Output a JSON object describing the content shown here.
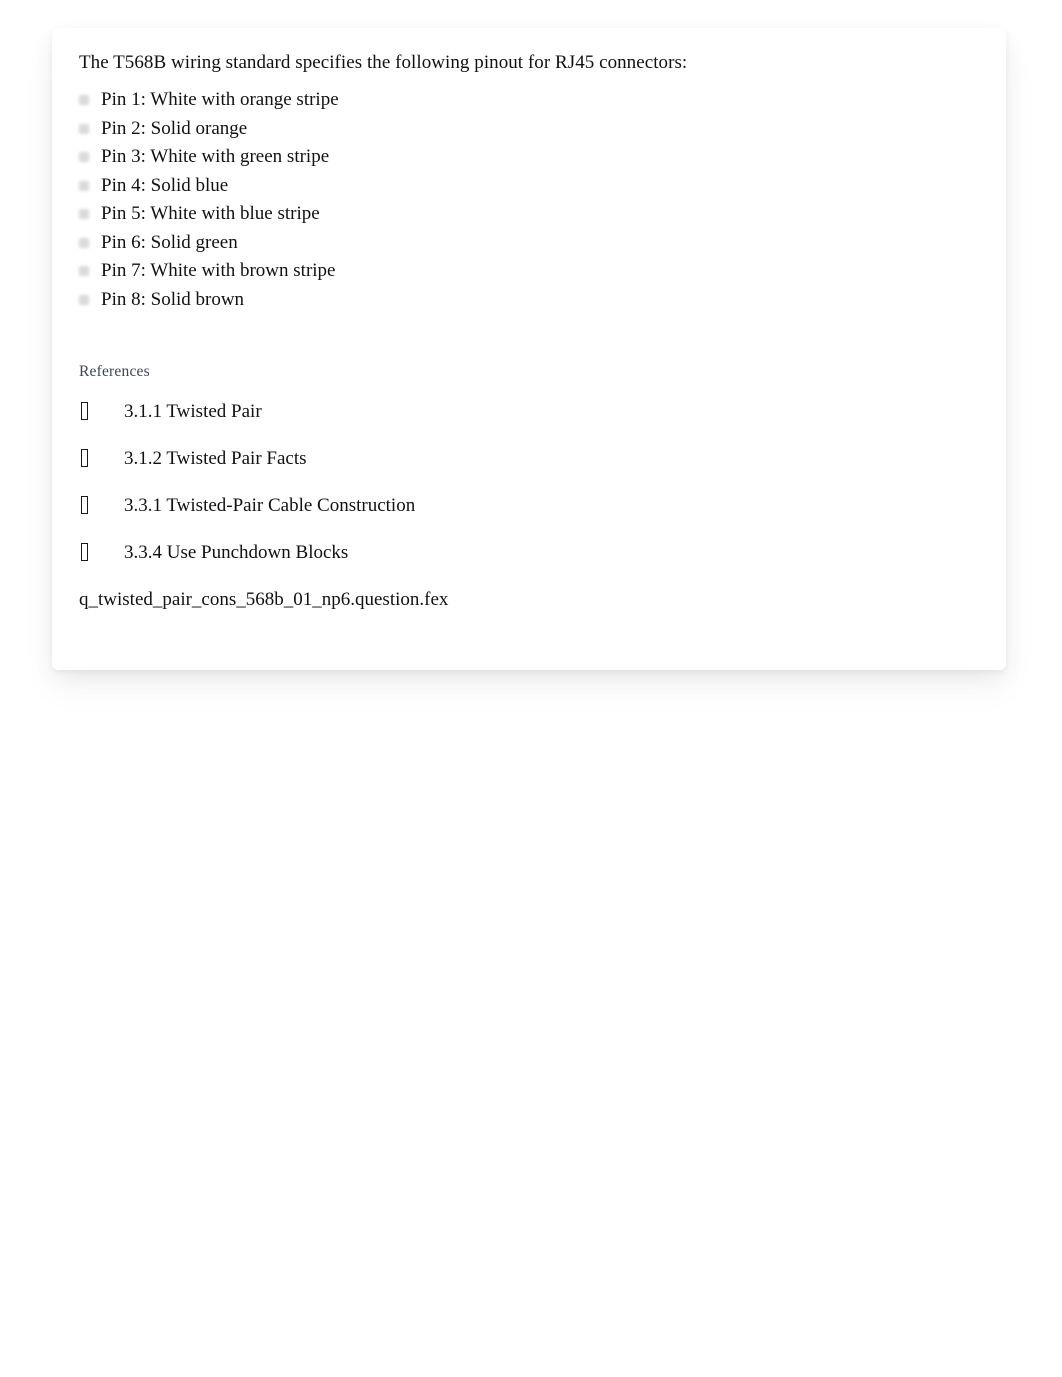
{
  "card": {
    "intro": "The T568B wiring standard specifies the following pinout for RJ45 connectors:",
    "pinout": [
      "Pin 1: White with orange stripe",
      "Pin 2: Solid orange",
      "Pin 3: White with green stripe",
      "Pin 4: Solid blue",
      "Pin 5: White with blue stripe",
      "Pin 6: Solid green",
      "Pin 7: White with brown stripe",
      "Pin 8: Solid brown"
    ],
    "references": {
      "heading": "References",
      "items": [
        "3.1.1 Twisted Pair",
        "3.1.2 Twisted Pair Facts",
        "3.3.1 Twisted-Pair Cable Construction",
        "3.3.4 Use Punchdown Blocks"
      ],
      "bullet_icon": "missing-glyph-box-icon"
    },
    "filename": "q_twisted_pair_cons_568b_01_np6.question.fex",
    "colors": {
      "body_text": "#111111",
      "references_heading": "#3d4557",
      "bullet_gray": "#d8d8d8",
      "card_background": "#ffffff",
      "page_background": "#ffffff"
    }
  }
}
